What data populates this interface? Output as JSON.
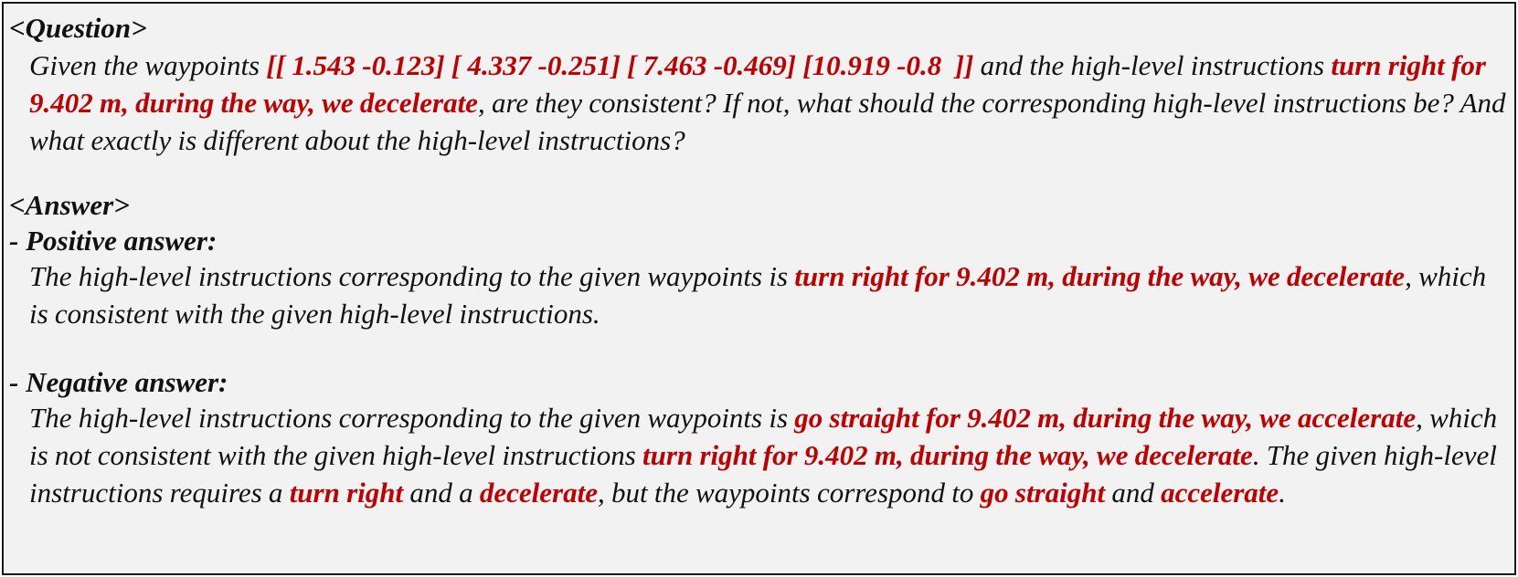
{
  "question": {
    "heading": "<Question>",
    "p1": "Given the waypoints ",
    "waypoints": "[[ 1.543 -0.123] [ 4.337 -0.251] [ 7.463 -0.469] [10.919 -0.8  ]]",
    "p2": " and the high-level instructions ",
    "instruction": "turn right for 9.402 m, during the way, we decelerate",
    "p3": ", are they consistent? If not, what should the corresponding high-level instructions be? And what exactly is different about the high-level instructions?"
  },
  "answer": {
    "heading": "<Answer>",
    "positive": {
      "heading": "- Positive answer:",
      "p1": "The high-level instructions corresponding to the given waypoints is ",
      "instruction": "turn right for 9.402 m, during the way, we decelerate",
      "p2": ", which is consistent with the given high-level instructions."
    },
    "negative": {
      "heading": "- Negative answer:",
      "p1": "The high-level instructions corresponding to the given waypoints is ",
      "instruction": "go straight for 9.402 m, during the way, we accelerate",
      "p2": ", which is not consistent with the given high-level instructions ",
      "given_instruction": "turn right for 9.402 m, during the way, we decelerate",
      "p3": ". The given high-level instructions requires a ",
      "given_turn": "turn right",
      "p4": " and a ",
      "given_speed": "decelerate",
      "p5": ", but the waypoints correspond to ",
      "actual_turn": "go straight",
      "p6": " and ",
      "actual_speed": "accelerate",
      "p7": "."
    }
  },
  "colors": {
    "highlight": "#c00000",
    "background": "#f2f2f2",
    "border": "#1a1a1a"
  }
}
